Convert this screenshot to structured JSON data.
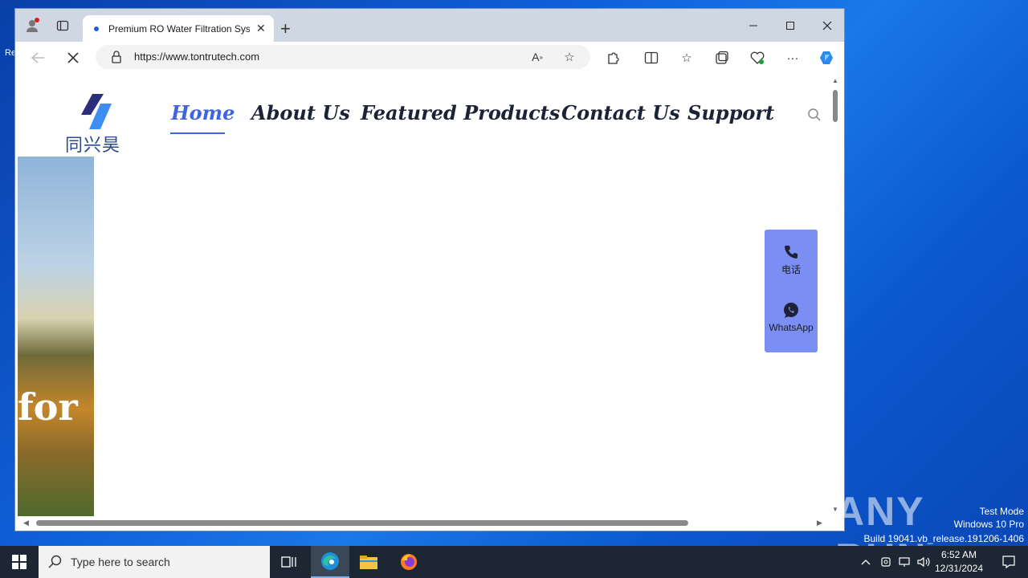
{
  "browser": {
    "tab_title": "Premium RO Water Filtration Sys",
    "url": "https://www.tontrutech.com"
  },
  "site": {
    "logo_text": "同兴昊创",
    "nav": [
      {
        "label": "Home",
        "active": true
      },
      {
        "label": "About Us",
        "active": false
      },
      {
        "label": "Featured Products",
        "active": false
      },
      {
        "label": "Contact Us",
        "active": false
      },
      {
        "label": "Support",
        "active": false
      }
    ],
    "hero_text": "for",
    "contact_panel": {
      "phone_label": "电话",
      "whatsapp_label": "WhatsApp"
    }
  },
  "taskbar": {
    "search_placeholder": "Type here to search",
    "time": "6:52 AM",
    "date": "12/31/2024"
  },
  "watermark": {
    "line1": "Test Mode",
    "line2": "Windows 10 Pro",
    "line3": "Build 19041.vb_release.191206-1406",
    "brand": "ANY RUN"
  },
  "colors": {
    "nav_active": "#4063e0",
    "contact_panel_bg": "#7b8ef4"
  }
}
